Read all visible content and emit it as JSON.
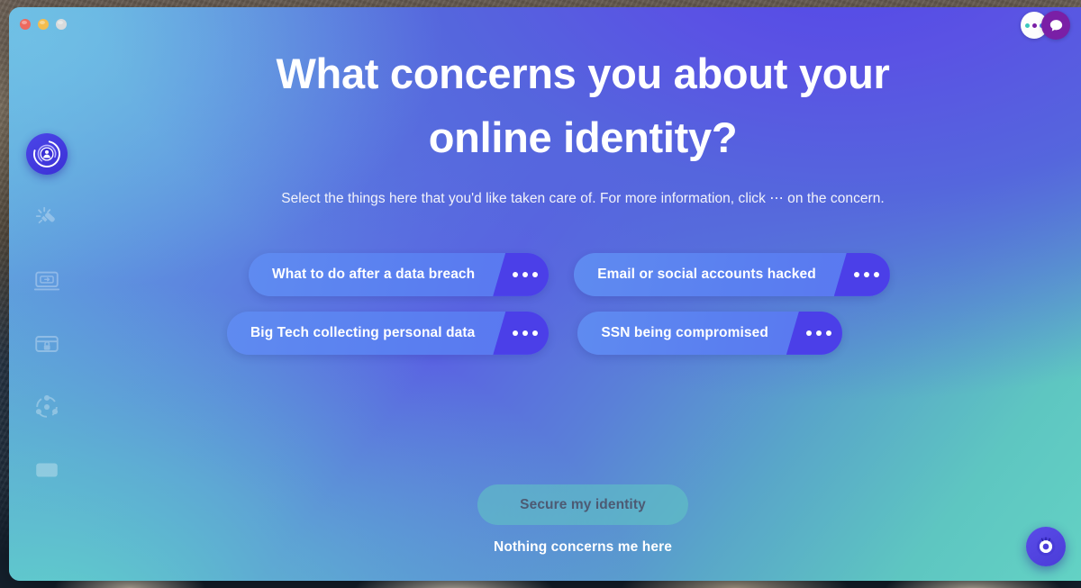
{
  "window": {
    "traffic_lights": [
      {
        "name": "close",
        "color": "#ec6a5f"
      },
      {
        "name": "minimize",
        "color": "#f4bd4f"
      },
      {
        "name": "zoom",
        "color": "#d9dbdc"
      }
    ],
    "background_gradient": {
      "from": "#63d2c4",
      "mid": "#5a80d8",
      "to": "#5247e8"
    }
  },
  "top_right": {
    "members_avatar_icon": "three-dots-icon",
    "member_dot_colors": [
      "#3cc7bd",
      "#7a1fa6",
      "#4b6fe8"
    ],
    "chat_avatar_icon": "chat-bubble-icon",
    "chat_avatar_color": "#7a1fa6"
  },
  "sidebar": {
    "brand": {
      "icon": "identity-target-icon",
      "color": "#4b46e8"
    },
    "items": [
      {
        "icon": "sparkle-wand-icon",
        "active": false
      },
      {
        "icon": "monitor-scan-icon",
        "active": false
      },
      {
        "icon": "card-lock-icon",
        "active": false
      },
      {
        "icon": "network-nodes-icon",
        "active": false
      },
      {
        "icon": "folder-icon",
        "active": false
      }
    ]
  },
  "main": {
    "title": "What concerns you about your online identity?",
    "subtitle": "Select the things here that you'd like taken care of. For more information, click ⋯ on the concern.",
    "chips": [
      {
        "label": "What to do after a data breach",
        "more_icon": "ellipsis-icon",
        "selected": false
      },
      {
        "label": "Email or social accounts hacked",
        "more_icon": "ellipsis-icon",
        "selected": false
      },
      {
        "label": "Big Tech collecting personal data",
        "more_icon": "ellipsis-icon",
        "selected": false
      },
      {
        "label": "SSN being compromised",
        "more_icon": "ellipsis-icon",
        "selected": false
      }
    ],
    "chip_colors": {
      "pill": "#5a7ff0",
      "more": "#4b3fe8",
      "text": "#ffffff"
    }
  },
  "actions": {
    "primary_label": "Secure my identity",
    "primary_disabled": true,
    "primary_bg": "#61c8c3",
    "primary_text_color": "#4d5a73",
    "secondary_label": "Nothing concerns me here"
  },
  "help_fab": {
    "icon": "target-eye-icon",
    "color": "#4a3cd8"
  }
}
